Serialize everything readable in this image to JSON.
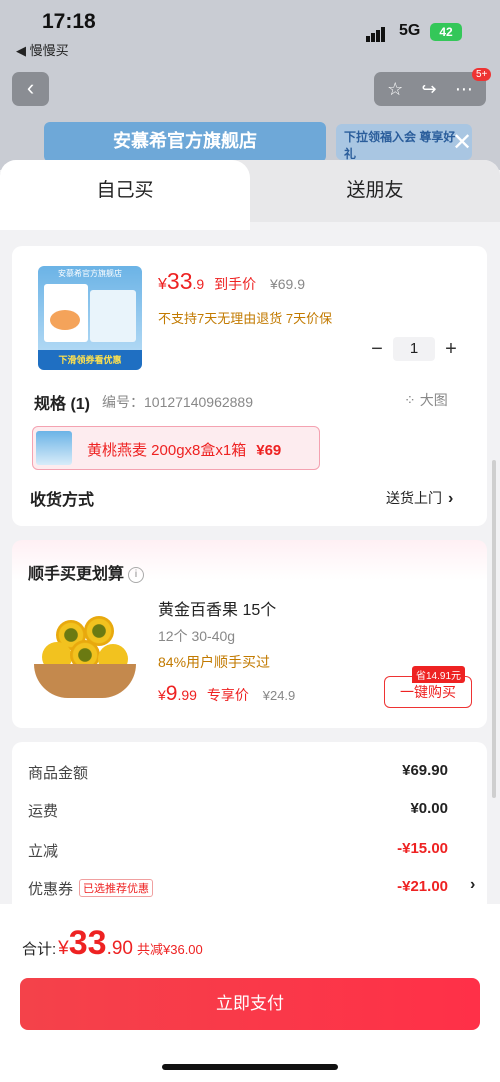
{
  "status": {
    "time": "17:18",
    "back_app": "◀ 慢慢买",
    "network": "5G",
    "battery": "42"
  },
  "bg": {
    "store_name": "安慕希官方旗舰店",
    "promo": "下拉领福入会 尊享好礼",
    "nav_badge": "5+"
  },
  "tabs": [
    {
      "label": "自己买"
    },
    {
      "label": "送朋友"
    }
  ],
  "product": {
    "image_label": "安慕希官方旗舰店",
    "image_bar": "下滑领券看优惠",
    "price_symbol": "¥",
    "price_int": "33",
    "price_dec": ".9",
    "price_suffix": "到手价",
    "orig_price": "¥69.9",
    "policy": "不支持7天无理由退货  7天价保",
    "qty": "1",
    "minus": "−",
    "plus": "+"
  },
  "spec": {
    "title": "规格 (1)",
    "code": "编号：10127140962889",
    "big_img": "大图",
    "chip_text": "黄桃燕麦 200gx8盒x1箱",
    "chip_price": "¥69"
  },
  "shipping": {
    "label": "收货方式",
    "value": "送货上门"
  },
  "addon": {
    "title": "顺手买更划算",
    "name": "黄金百香果 15个",
    "spec": "12个 30-40g",
    "stat": "84%用户顺手买过",
    "price_symbol": "¥",
    "price_int": "9",
    "price_dec": ".99",
    "price_suffix": "专享价",
    "orig_price": "¥24.9",
    "save_tag": "省14.91元",
    "buy_label": "一键购买"
  },
  "summary": {
    "rows": [
      {
        "label": "商品金额",
        "value": "¥69.90"
      },
      {
        "label": "运费",
        "value": "¥0.00"
      },
      {
        "label": "立减",
        "value": "-¥15.00"
      },
      {
        "label": "优惠券",
        "value": "-¥21.00",
        "tag": "已选推荐优惠"
      }
    ]
  },
  "footer": {
    "total_label": "合计:",
    "total_symbol": "¥",
    "total_int": "33",
    "total_dec": ".90",
    "total_saved": "共减¥36.00",
    "pay_label": "立即支付"
  }
}
